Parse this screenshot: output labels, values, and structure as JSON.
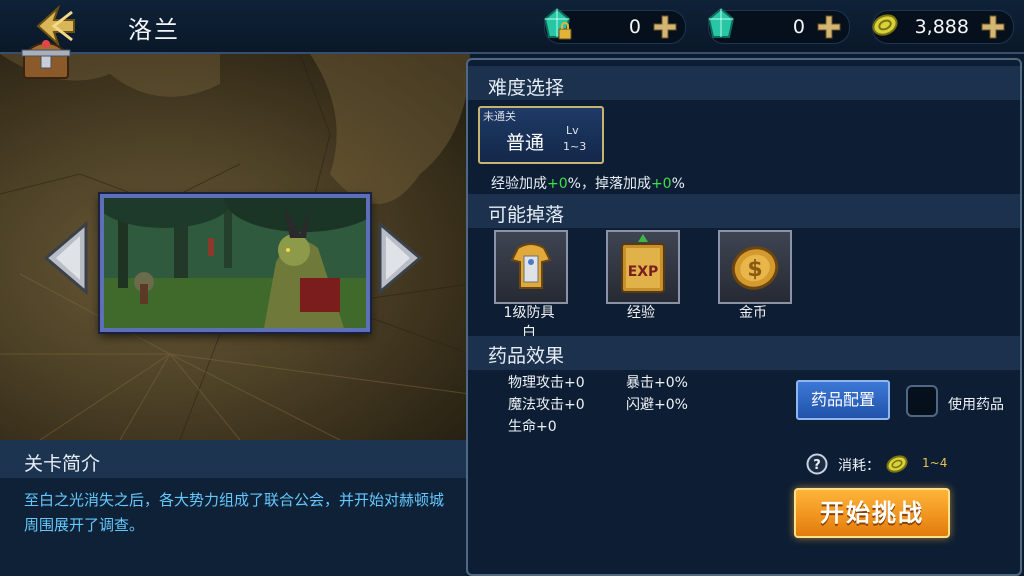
{
  "header": {
    "title": "洛兰",
    "currencies": [
      {
        "icon": "locked-crystal-icon",
        "value": "0"
      },
      {
        "icon": "crystal-icon",
        "value": "0"
      },
      {
        "icon": "gold-coin-icon",
        "value": "3,888"
      }
    ]
  },
  "map": {
    "chest_icon": "treasure-chest-icon",
    "stage_preview": "goblin-forest-scene"
  },
  "intro": {
    "title": "关卡简介",
    "text": "至白之光消失之后，各大势力组成了联合公会，并开始对赫顿城周围展开了调查。"
  },
  "difficulty": {
    "section_title": "难度选择",
    "tag": "未通关",
    "name": "普通",
    "lv_label": "Lv",
    "lv_range": "1~3",
    "bonus_exp_label": "经验加成",
    "bonus_exp_value": "+0",
    "bonus_sep": "%，掉落加成",
    "bonus_drop_value": "+0",
    "bonus_end": "%"
  },
  "drops": {
    "section_title": "可能掉落",
    "items": [
      {
        "icon": "armor-icon",
        "label_line1": "1级防具",
        "label_line2": "白"
      },
      {
        "icon": "exp-book-icon",
        "label_line1": "经验",
        "label_line2": ""
      },
      {
        "icon": "gold-coin-icon",
        "label_line1": "金币",
        "label_line2": ""
      }
    ]
  },
  "potions": {
    "section_title": "药品效果",
    "stats": [
      "物理攻击+0",
      "魔法攻击+0",
      "生命+0",
      "暴击+0%",
      "闪避+0%"
    ],
    "config_button": "药品配置",
    "use_label": "使用药品",
    "use_checked": false
  },
  "footer": {
    "cost_label": "消耗：",
    "cost_value": "1~4",
    "start_button": "开始挑战"
  },
  "colors": {
    "accent_green": "#3de04a",
    "intro_text": "#64c8ff",
    "start_orange": "#f39a22"
  }
}
